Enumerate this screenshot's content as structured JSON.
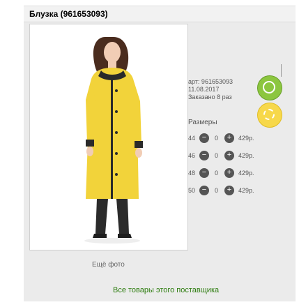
{
  "product": {
    "title": "Блузка (961653093)",
    "article": "арт: 961653093",
    "date": "11.08.2017",
    "ordered": "Заказано 8 раз"
  },
  "sizes_heading": "Размеры",
  "sizes": [
    {
      "size": "44",
      "qty": "0",
      "price": "429р."
    },
    {
      "size": "46",
      "qty": "0",
      "price": "429р."
    },
    {
      "size": "48",
      "qty": "0",
      "price": "429р."
    },
    {
      "size": "50",
      "qty": "0",
      "price": "429р."
    }
  ],
  "links": {
    "more_photo": "Ещё фото",
    "all_goods": "Все товары этого поставщика"
  },
  "colors": {
    "accent_green": "#8cc63f",
    "accent_yellow": "#f7d84a",
    "coat_yellow": "#f2d33a"
  },
  "icons": {
    "minus": "−",
    "plus": "+"
  }
}
